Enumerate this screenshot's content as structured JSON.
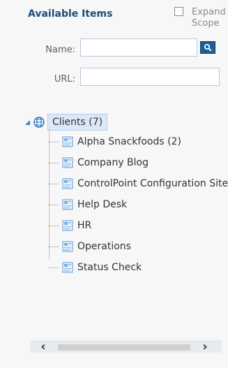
{
  "panel": {
    "title": "Available Items",
    "expand_scope_label": "Expand Scope"
  },
  "filters": {
    "name_label": "Name:",
    "name_value": "",
    "url_label": "URL:",
    "url_value": ""
  },
  "tree": {
    "root": {
      "label": "Clients (7)"
    },
    "children": [
      {
        "label": "Alpha Snackfoods (2)"
      },
      {
        "label": "Company Blog"
      },
      {
        "label": "ControlPoint Configuration Site"
      },
      {
        "label": "Help Desk"
      },
      {
        "label": "HR"
      },
      {
        "label": "Operations"
      },
      {
        "label": "Status Check"
      }
    ]
  },
  "scrollbar": {
    "left_arrow": "‹",
    "right_arrow": "›"
  },
  "colors": {
    "title_blue": "#1e4b7a",
    "search_button": "#1f5e97",
    "selected_root_bg": "#dbe8f7"
  }
}
